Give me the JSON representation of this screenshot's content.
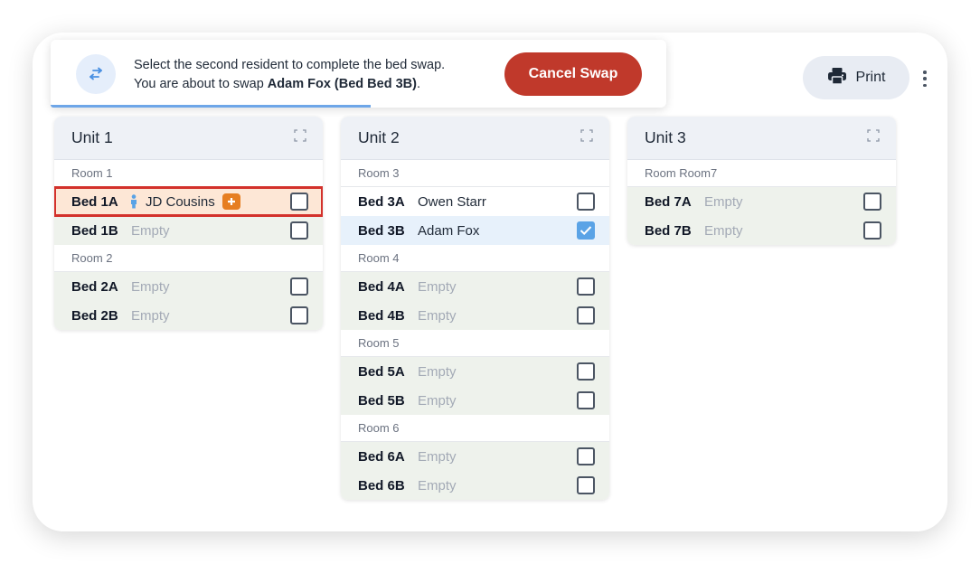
{
  "banner": {
    "line1": "Select the second resident to complete the bed swap.",
    "line2_prefix": "You are about to swap ",
    "line2_name": "Adam Fox (Bed Bed 3B)",
    "line2_suffix": ".",
    "cancel_label": "Cancel Swap"
  },
  "toolbar": {
    "print_label": "Print"
  },
  "units": [
    {
      "title": "Unit 1",
      "rooms": [
        {
          "label": "Room 1",
          "beds": [
            {
              "bed": "Bed 1A",
              "resident": "JD Cousins",
              "checked": false
            },
            {
              "bed": "Bed 1B",
              "resident": "Empty",
              "checked": false
            }
          ]
        },
        {
          "label": "Room 2",
          "beds": [
            {
              "bed": "Bed 2A",
              "resident": "Empty",
              "checked": false
            },
            {
              "bed": "Bed 2B",
              "resident": "Empty",
              "checked": false
            }
          ]
        }
      ]
    },
    {
      "title": "Unit 2",
      "rooms": [
        {
          "label": "Room 3",
          "beds": [
            {
              "bed": "Bed 3A",
              "resident": "Owen Starr",
              "checked": false
            },
            {
              "bed": "Bed 3B",
              "resident": "Adam Fox",
              "checked": true
            }
          ]
        },
        {
          "label": "Room 4",
          "beds": [
            {
              "bed": "Bed 4A",
              "resident": "Empty",
              "checked": false
            },
            {
              "bed": "Bed 4B",
              "resident": "Empty",
              "checked": false
            }
          ]
        },
        {
          "label": "Room 5",
          "beds": [
            {
              "bed": "Bed 5A",
              "resident": "Empty",
              "checked": false
            },
            {
              "bed": "Bed 5B",
              "resident": "Empty",
              "checked": false
            }
          ]
        },
        {
          "label": "Room 6",
          "beds": [
            {
              "bed": "Bed 6A",
              "resident": "Empty",
              "checked": false
            },
            {
              "bed": "Bed 6B",
              "resident": "Empty",
              "checked": false
            }
          ]
        }
      ]
    },
    {
      "title": "Unit 3",
      "rooms": [
        {
          "label": "Room Room7",
          "beds": [
            {
              "bed": "Bed 7A",
              "resident": "Empty",
              "checked": false
            },
            {
              "bed": "Bed 7B",
              "resident": "Empty",
              "checked": false
            }
          ]
        }
      ]
    }
  ],
  "colors": {
    "accent_red": "#c0392b",
    "highlight_border": "#d3312b",
    "checkbox_checked": "#5aa3e6",
    "plus_badge": "#e67e22",
    "person_icon": "#5aa3e6"
  }
}
